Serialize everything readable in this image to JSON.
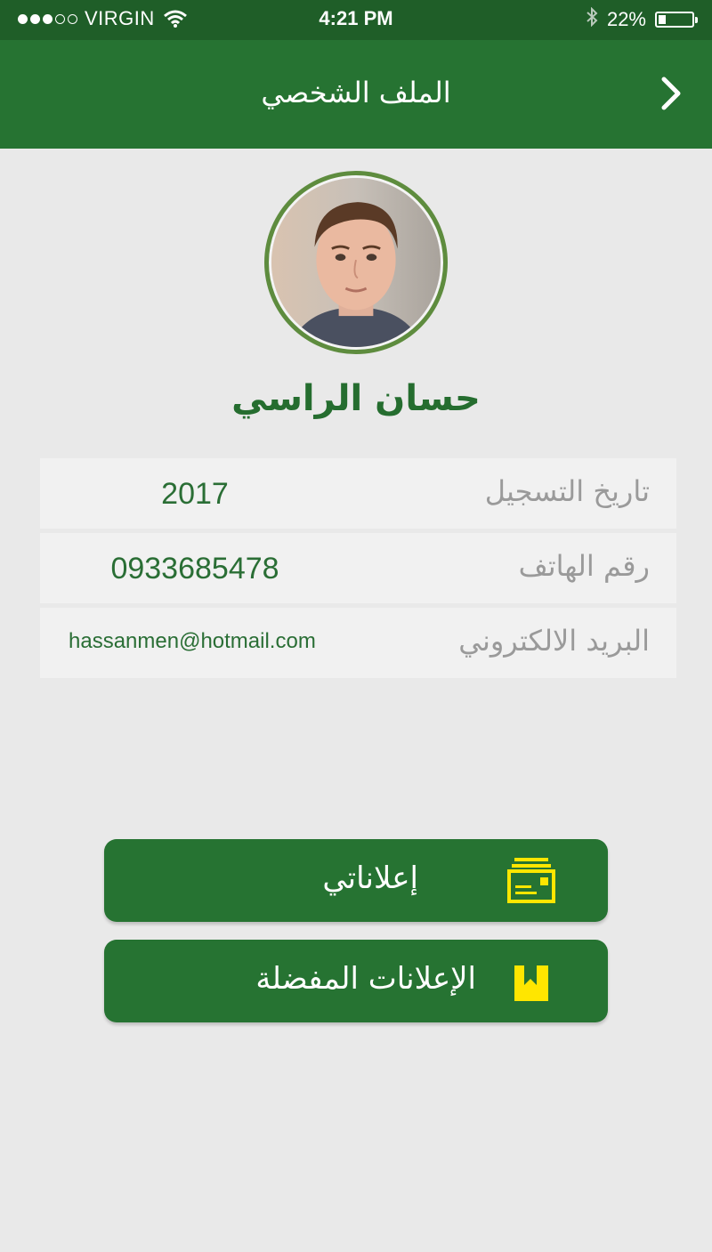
{
  "status_bar": {
    "signal_bars_filled": 3,
    "signal_bars_total": 5,
    "carrier": "VIRGIN",
    "time": "4:21 PM",
    "battery": "22%",
    "battery_level": 0.22,
    "icons": [
      "wifi-icon",
      "bluetooth-icon",
      "battery-icon"
    ]
  },
  "header": {
    "title": "الملف الشخصي",
    "nav_icon": "chevron-right-icon"
  },
  "profile": {
    "name": "حسان الراسي",
    "avatar": "user-photo"
  },
  "details": [
    {
      "label": "تاريخ التسجيل",
      "value": "2017"
    },
    {
      "label": "رقم الهاتف",
      "value": "0933685478"
    },
    {
      "label": "البريد الالكتروني",
      "value": "hassanmen@hotmail.com"
    }
  ],
  "actions": {
    "my_ads": {
      "label": "إعلاناتي",
      "icon": "ads-stack-icon"
    },
    "favorites": {
      "label": "الإعلانات المفضلة",
      "icon": "bookmark-icon"
    }
  },
  "colors": {
    "primary_green": "#267332",
    "status_bar_green": "#1f5e28",
    "accent_yellow": "#ffe600",
    "text_green": "#256d2f",
    "label_gray": "#9a9a9a",
    "background": "#e9e9e9"
  }
}
